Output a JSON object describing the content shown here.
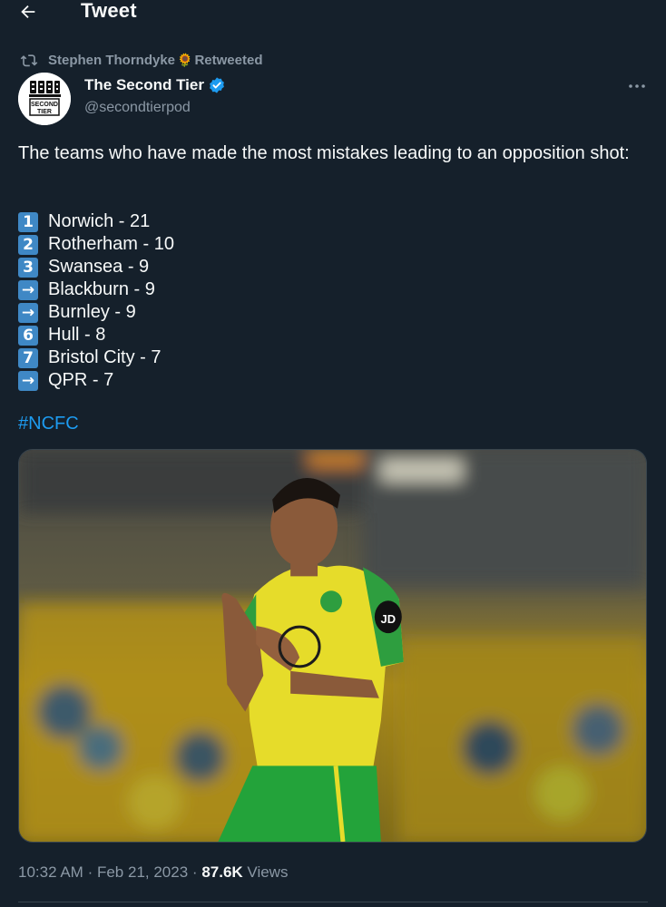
{
  "header": {
    "title": "Tweet",
    "back_icon": "arrow-left-icon"
  },
  "retweet": {
    "user": "Stephen Thorndyke",
    "emoji": "🌻",
    "label": "Retweeted",
    "icon": "retweet-icon"
  },
  "author": {
    "name": "The Second Tier",
    "handle": "@secondtierpod",
    "verified": true,
    "avatar_text": [
      "SECOND",
      "TIER"
    ]
  },
  "tweet": {
    "text": "The teams who have made the most mistakes leading to an opposition shot:",
    "list": [
      {
        "rank": "1",
        "team": "Norwich - 21"
      },
      {
        "rank": "2",
        "team": "Rotherham - 10"
      },
      {
        "rank": "3",
        "team": "Swansea - 9"
      },
      {
        "rank": "→",
        "team": "Blackburn - 9"
      },
      {
        "rank": "→",
        "team": "Burnley - 9"
      },
      {
        "rank": "6",
        "team": "Hull - 8"
      },
      {
        "rank": "7",
        "team": "Bristol City - 7"
      },
      {
        "rank": "→",
        "team": "QPR - 7"
      }
    ],
    "hashtag": "#NCFC",
    "media_alt": "Norwich City player in yellow and green kit applauding in stadium",
    "shirt_logo": "JD"
  },
  "meta": {
    "time": "10:32 AM",
    "date": "Feb 21, 2023",
    "views_count": "87.6K",
    "views_label": "Views",
    "separator": "·"
  },
  "colors": {
    "background": "#15202b",
    "accent": "#1d9bf0",
    "muted": "#8b98a5",
    "badge": "#3f88c5"
  }
}
